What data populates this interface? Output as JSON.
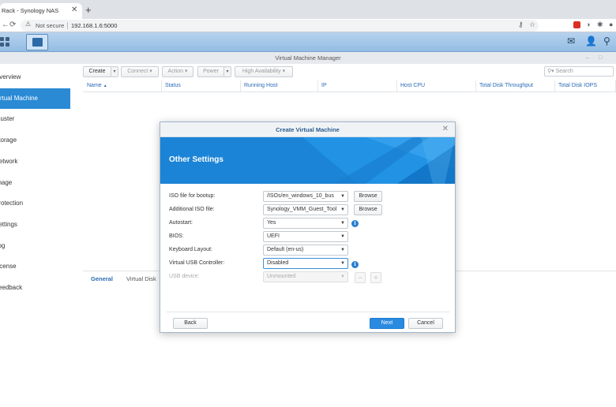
{
  "browser": {
    "tab_title": "Rack - Synology NAS",
    "tab_close": "✕",
    "new_tab": "+",
    "security_label": "Not secure",
    "url": "192.168.1.6:5000"
  },
  "window": {
    "title": "Virtual Machine Manager",
    "minimize": "–",
    "maximize": "□"
  },
  "sidebar": {
    "items": [
      {
        "label": "Overview"
      },
      {
        "label": "Virtual Machine"
      },
      {
        "label": "Cluster"
      },
      {
        "label": "Storage"
      },
      {
        "label": "Network"
      },
      {
        "label": "Image"
      },
      {
        "label": "Protection"
      },
      {
        "label": "Settings"
      },
      {
        "label": "Log"
      },
      {
        "label": "License"
      },
      {
        "label": "Feedback"
      }
    ],
    "active_index": 1
  },
  "toolbar": {
    "create": "Create",
    "connect": "Connect",
    "action": "Action",
    "power": "Power",
    "high_availability": "High Availability",
    "search_placeholder": "Search"
  },
  "table": {
    "columns": [
      "Name",
      "Status",
      "Running Host",
      "IP",
      "Host CPU",
      "Total Disk Throughput",
      "Total Disk IOPS"
    ],
    "sort_indicator": "▲"
  },
  "bottom_tabs": {
    "general": "General",
    "virtual_disk": "Virtual Disk"
  },
  "dialog": {
    "title": "Create Virtual Machine",
    "close": "✕",
    "section_title": "Other Settings",
    "fields": {
      "iso_boot": {
        "label": "ISO file for bootup:",
        "value": "/ISOs/en_windows_10_bus",
        "button": "Browse"
      },
      "additional_iso": {
        "label": "Additional ISO file:",
        "value": "Synology_VMM_Guest_Tool",
        "button": "Browse"
      },
      "autostart": {
        "label": "Autostart:",
        "value": "Yes"
      },
      "bios": {
        "label": "BIOS:",
        "value": "UEFI"
      },
      "keyboard": {
        "label": "Keyboard Layout:",
        "value": "Default (en-us)"
      },
      "usb_controller": {
        "label": "Virtual USB Controller:",
        "value": "Disabled"
      },
      "usb_device": {
        "label": "USB device:",
        "value": "Unmounted"
      }
    },
    "info_glyph": "i",
    "usb_remove": "−",
    "usb_add": "+",
    "back": "Back",
    "next": "Next",
    "cancel": "Cancel"
  },
  "colors": {
    "accent": "#2a8ad4",
    "banner": "#1b84d6",
    "primary_button": "#2a8ae0"
  }
}
